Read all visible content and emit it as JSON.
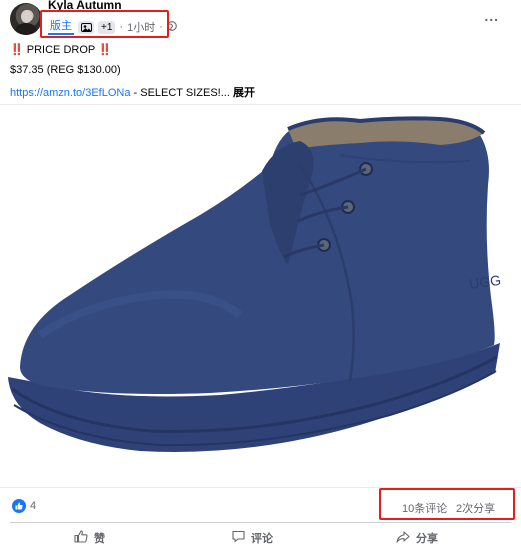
{
  "post": {
    "author": "Kyla Autumn",
    "meta": {
      "admin_badge": "版主",
      "plus": "+1",
      "time": "1小时",
      "separator": "·"
    },
    "text": {
      "line1_prefix": "‼️",
      "line1": "PRICE DROP",
      "line1_suffix": "‼️",
      "line2": "$37.35 (REG $130.00)",
      "link": "https://amzn.to/3EfLONa",
      "line3_rest": " - SELECT SIZES!...",
      "expand": "展开"
    },
    "more_icon": "...",
    "image": {
      "subject": "navy suede chukka boot",
      "boot_color": "#344a7f",
      "sole_color": "#2f4277",
      "lining_color": "#8a7d6b"
    }
  },
  "stats": {
    "likes": "4",
    "comments": "10条评论",
    "shares": "2次分享"
  },
  "actions": {
    "like": "赞",
    "comment": "评论",
    "share": "分享"
  },
  "colors": {
    "accent": "#1877f2",
    "highlight": "#e0201c",
    "muted": "#65676b"
  }
}
